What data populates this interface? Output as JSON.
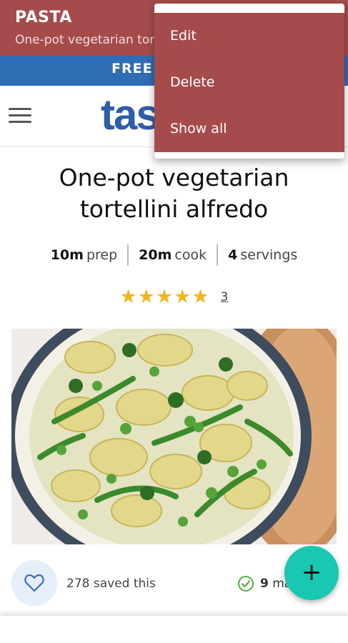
{
  "appbar": {
    "title": "PASTA",
    "subtitle": "One-pot vegetarian tortellini alfredo"
  },
  "promo": {
    "text": "FREE"
  },
  "site": {
    "logo_text": "taste"
  },
  "recipe": {
    "title_line1": "One-pot vegetarian",
    "title_line2": "tortellini alfredo",
    "prep_value": "10m",
    "prep_label": "prep",
    "cook_value": "20m",
    "cook_label": "cook",
    "servings_value": "4",
    "servings_label": "servings",
    "stars": "★★★★★",
    "rating_count": "3"
  },
  "social": {
    "saved_text": "278 saved this",
    "made_count": "9",
    "made_label": "made this"
  },
  "menu": {
    "items": [
      {
        "label": "Edit"
      },
      {
        "label": "Delete"
      },
      {
        "label": "Show all"
      }
    ]
  },
  "fab": {
    "label": "+"
  },
  "colors": {
    "appbar": "#a54b4b",
    "promo": "#2f6db4",
    "logo": "#2f5da8",
    "stars": "#f2b619",
    "fab": "#19c8b0"
  }
}
